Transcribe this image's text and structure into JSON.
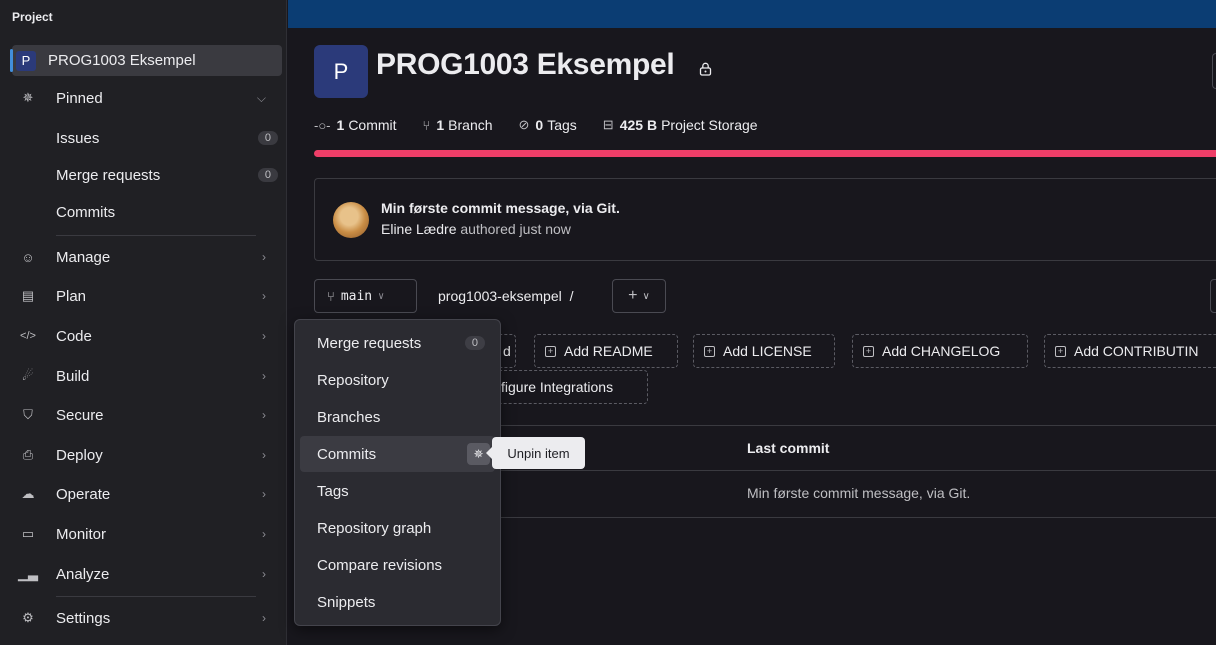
{
  "sidebar": {
    "header": "Project",
    "project": {
      "avatar": "P",
      "name": "PROG1003 Eksempel"
    },
    "pinned": {
      "label": "Pinned",
      "icon": "pin-icon"
    },
    "pinned_items": [
      {
        "label": "Issues",
        "badge": "0"
      },
      {
        "label": "Merge requests",
        "badge": "0"
      },
      {
        "label": "Commits"
      }
    ],
    "items": [
      {
        "label": "Manage",
        "icon": "users-icon"
      },
      {
        "label": "Plan",
        "icon": "calendar-icon"
      },
      {
        "label": "Code",
        "icon": "code-icon"
      },
      {
        "label": "Build",
        "icon": "rocket-icon"
      },
      {
        "label": "Secure",
        "icon": "shield-icon"
      },
      {
        "label": "Deploy",
        "icon": "deploy-icon"
      },
      {
        "label": "Operate",
        "icon": "cloud-icon"
      },
      {
        "label": "Monitor",
        "icon": "monitor-icon"
      },
      {
        "label": "Analyze",
        "icon": "chart-icon"
      },
      {
        "label": "Settings",
        "icon": "gear-icon"
      }
    ]
  },
  "project": {
    "avatar": "P",
    "title": "PROG1003 Eksempel",
    "stats": {
      "commits_count": "1",
      "commits_label": "Commit",
      "branches_count": "1",
      "branches_label": "Branch",
      "tags_count": "0",
      "tags_label": "Tags",
      "storage_size": "425 B",
      "storage_label": "Project Storage"
    },
    "accent_color": "#ee3e68"
  },
  "last_commit": {
    "message": "Min første commit message, via Git.",
    "author": "Eline Lædre",
    "meta": "authored just now"
  },
  "repo_bar": {
    "branch": "main",
    "path": "prog1003-eksempel",
    "path_sep": "/",
    "plus": "+"
  },
  "quick_actions": {
    "partial_first": "d",
    "add_readme": "Add README",
    "add_license": "Add LICENSE",
    "add_changelog": "Add CHANGELOG",
    "add_contributing": "Add CONTRIBUTIN",
    "configure_integrations": "figure Integrations"
  },
  "file_table": {
    "header_last_commit": "Last commit",
    "row_last_commit": "Min første commit message, via Git."
  },
  "code_menu": {
    "items": [
      {
        "label": "Merge requests",
        "badge": "0"
      },
      {
        "label": "Repository"
      },
      {
        "label": "Branches"
      },
      {
        "label": "Commits"
      },
      {
        "label": "Tags"
      },
      {
        "label": "Repository graph"
      },
      {
        "label": "Compare revisions"
      },
      {
        "label": "Snippets"
      }
    ],
    "tooltip": "Unpin item"
  }
}
